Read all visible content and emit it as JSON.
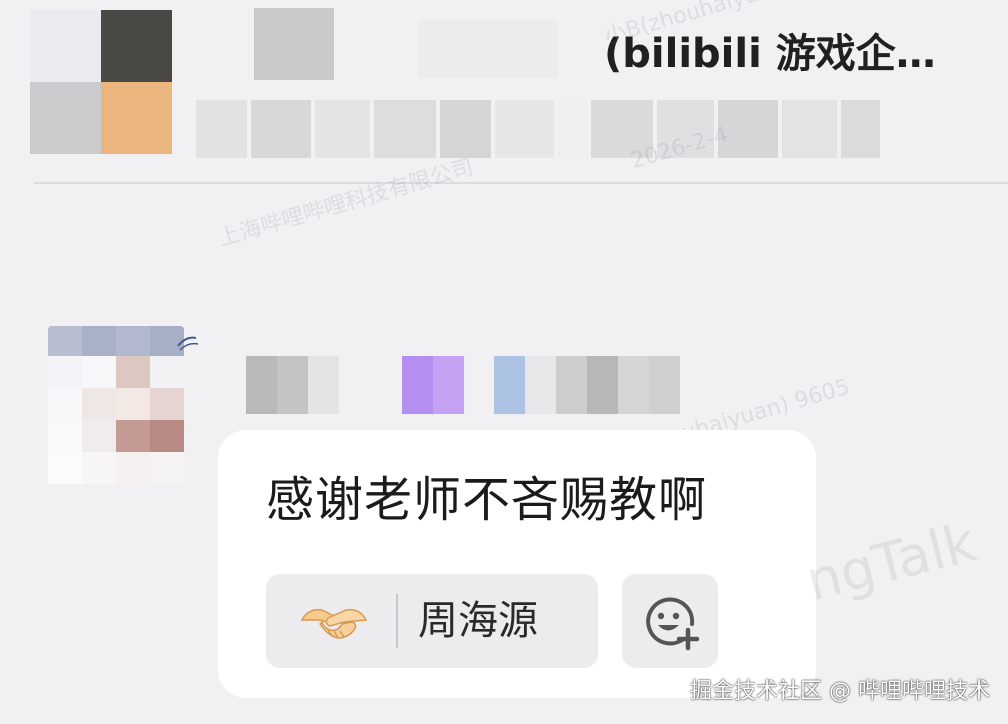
{
  "header": {
    "group_title": "(bilibili 游戏企…"
  },
  "message": {
    "text": "感谢老师不吝赐教啊",
    "reaction": {
      "emoji": "handshake-icon",
      "reactor_name": "周海源"
    },
    "add_reaction_icon": "add-emoji-icon"
  },
  "watermarks": {
    "company": "上海哔哩哔哩科技有限公司",
    "user": "小B(zhouhaiyuan) 9605",
    "date": "2026-2-4",
    "brand": "ngTalk"
  },
  "footer": {
    "credit": "掘金技术社区 @ 哔哩哔哩技术"
  }
}
